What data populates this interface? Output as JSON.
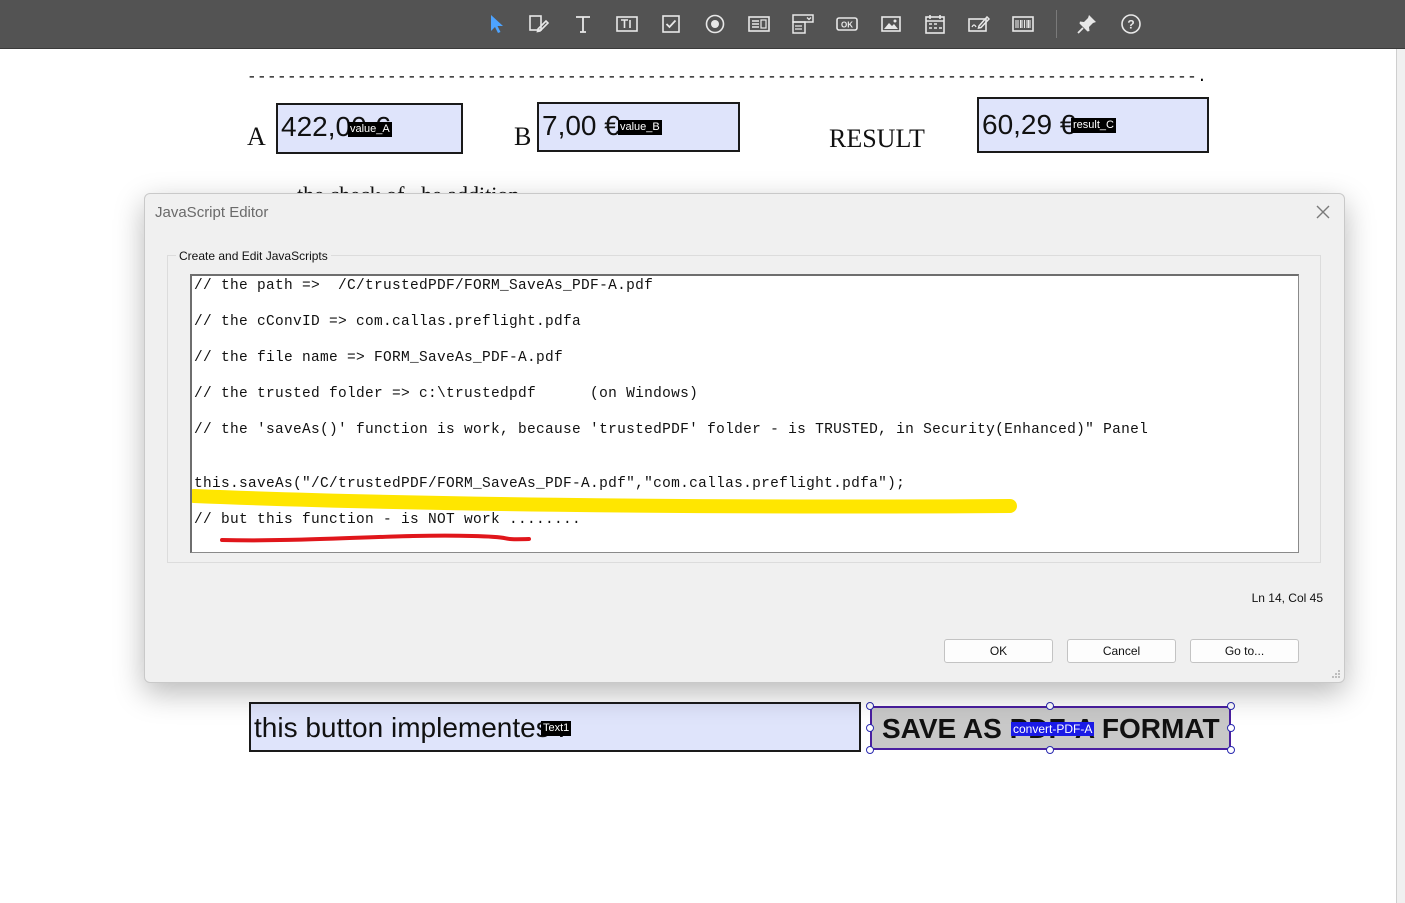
{
  "toolbar": {
    "tools": [
      {
        "icon": "select-arrow-icon"
      },
      {
        "icon": "edit-fields-icon"
      },
      {
        "icon": "text-tool-icon"
      },
      {
        "icon": "text-field-icon"
      },
      {
        "icon": "checkbox-icon"
      },
      {
        "icon": "radio-button-icon"
      },
      {
        "icon": "list-box-icon"
      },
      {
        "icon": "dropdown-icon"
      },
      {
        "icon": "button-ok-icon",
        "text": "OK"
      },
      {
        "icon": "image-icon"
      },
      {
        "icon": "date-field-icon"
      },
      {
        "icon": "signature-icon"
      },
      {
        "icon": "barcode-icon"
      },
      {
        "icon": "pin-icon"
      },
      {
        "icon": "help-icon",
        "text": "?"
      }
    ],
    "active_color": "#4da3ff"
  },
  "form": {
    "dash_line": "-----------------------------------------------------------------------------------------------.-",
    "label_a": "A",
    "label_b": "B",
    "label_result": "RESULT",
    "partial_text": "..the check of ..he addition",
    "value_a": {
      "value": "422,00 €",
      "name": "value_A"
    },
    "value_b": {
      "value": "7,00 €",
      "name": "value_B"
    },
    "result_c": {
      "value": "60,29 €",
      "name": "result_C"
    },
    "text1": {
      "value": "this button implementes :",
      "name": "Text1"
    },
    "button": {
      "value": "SAVE AS PDF-A FORMAT",
      "name": "convert-PDF-A"
    }
  },
  "dialog": {
    "title": "JavaScript Editor",
    "group_label": "Create and Edit JavaScripts",
    "code": [
      "// the path =>  /C/trustedPDF/FORM_SaveAs_PDF-A.pdf",
      "// the cConvID => com.callas.preflight.pdfa",
      "// the file name => FORM_SaveAs_PDF-A.pdf",
      "// the trusted folder => c:\\trustedpdf      (on Windows)",
      "// the 'saveAs()' function is work, because 'trustedPDF' folder - is TRUSTED, in Security(Enhanced)\" Panel",
      "this.saveAs(\"/C/trustedPDF/FORM_SaveAs_PDF-A.pdf\",\"com.callas.preflight.pdfa\");",
      "// but this function - is NOT work ........"
    ],
    "status": "Ln 14, Col 45",
    "buttons": {
      "ok": "OK",
      "cancel": "Cancel",
      "goto": "Go to..."
    },
    "highlight_color": "#ffe600",
    "underline_color": "#e0161b"
  }
}
